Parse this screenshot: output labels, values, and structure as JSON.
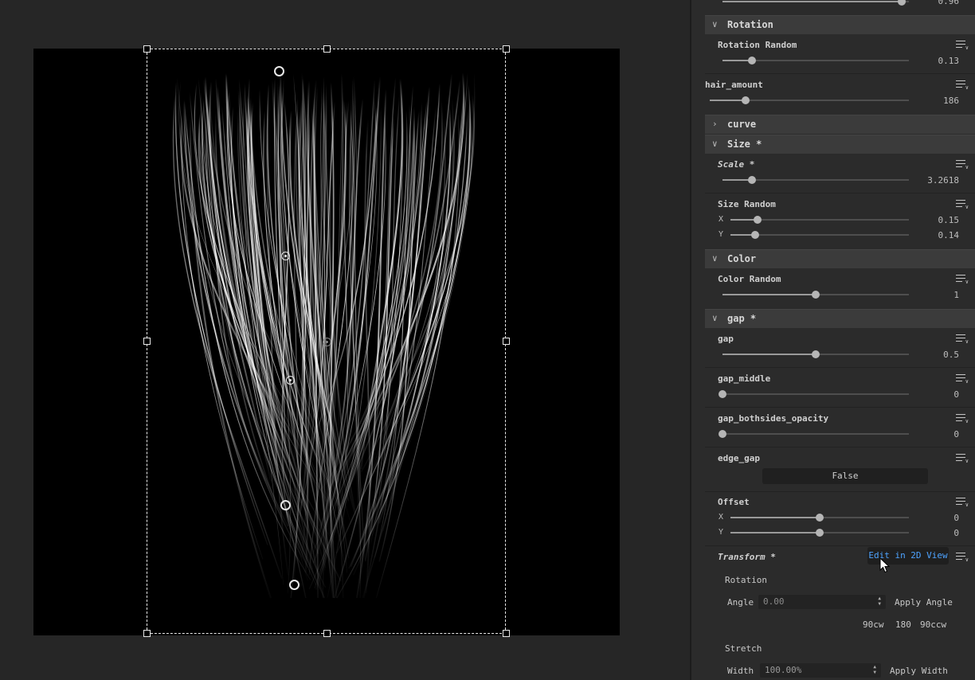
{
  "viewport": {
    "canvas_bg": "#000000",
    "hair_color": "#ffffff",
    "bbox_color": "#e8e8e8"
  },
  "panel": {
    "top_slider": {
      "value": "0.96",
      "fraction": 0.96
    },
    "rotation_section": {
      "title": "Rotation"
    },
    "rotation_random": {
      "label": "Rotation Random",
      "value": "0.13",
      "fraction": 0.16
    },
    "hair_amount": {
      "label": "hair_amount",
      "value": "186",
      "fraction": 0.18
    },
    "curve_section": {
      "title": "curve"
    },
    "size_section": {
      "title": "Size *"
    },
    "scale": {
      "label": "Scale *",
      "value": "3.2618",
      "fraction": 0.16
    },
    "size_random": {
      "label": "Size Random",
      "x": {
        "axis": "X",
        "value": "0.15",
        "fraction": 0.15
      },
      "y": {
        "axis": "Y",
        "value": "0.14",
        "fraction": 0.14
      }
    },
    "color_section": {
      "title": "Color"
    },
    "color_random": {
      "label": "Color Random",
      "value": "1",
      "fraction": 0.5
    },
    "gap_section": {
      "title": "gap *"
    },
    "gap": {
      "label": "gap",
      "value": "0.5",
      "fraction": 0.5
    },
    "gap_middle": {
      "label": "gap_middle",
      "value": "0",
      "fraction": 0.0
    },
    "gap_bothsides_opacity": {
      "label": "gap_bothsides_opacity",
      "value": "0",
      "fraction": 0.0
    },
    "edge_gap": {
      "label": "edge_gap",
      "button": "False"
    },
    "offset": {
      "label": "Offset",
      "x": {
        "axis": "X",
        "value": "0",
        "fraction": 0.5
      },
      "y": {
        "axis": "Y",
        "value": "0",
        "fraction": 0.5
      }
    },
    "transform": {
      "label": "Transform  *",
      "edit_button": "Edit in 2D View",
      "rotation_label": "Rotation",
      "angle_label": "Angle",
      "angle_value": "0.00",
      "apply_angle": "Apply Angle",
      "rot_90cw": "90cw",
      "rot_180": "180",
      "rot_90ccw": "90ccw",
      "stretch_label": "Stretch",
      "width_label": "Width",
      "width_value": "100.00%",
      "apply_width": "Apply Width"
    }
  }
}
